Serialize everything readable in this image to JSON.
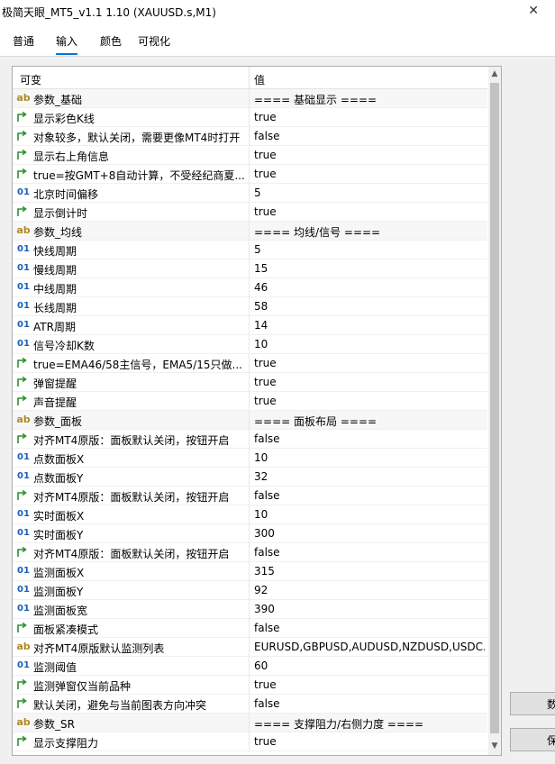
{
  "window": {
    "title": "极简天眼_MT5_v1.1 1.10 (XAUUSD.s,M1)",
    "close_glyph": "✕"
  },
  "tabs": [
    "普通",
    "输入",
    "颜色",
    "可视化"
  ],
  "active_tab": "输入",
  "grid": {
    "header": {
      "name": "可变",
      "value": "值"
    },
    "rows": [
      {
        "type": "ab",
        "name": "参数_基础",
        "value": "==== 基础显示 ====",
        "group": true
      },
      {
        "type": "bool",
        "name": "显示彩色K线",
        "value": "true"
      },
      {
        "type": "bool",
        "name": "对象较多，默认关闭，需要更像MT4时打开",
        "value": "false"
      },
      {
        "type": "bool",
        "name": "显示右上角信息",
        "value": "true"
      },
      {
        "type": "bool",
        "name": "true=按GMT+8自动计算，不受经纪商夏...",
        "value": "true"
      },
      {
        "type": "01",
        "name": "北京时间偏移",
        "value": "5"
      },
      {
        "type": "bool",
        "name": "显示倒计时",
        "value": "true"
      },
      {
        "type": "ab",
        "name": "参数_均线",
        "value": "==== 均线/信号 ====",
        "group": true
      },
      {
        "type": "01",
        "name": "快线周期",
        "value": "5"
      },
      {
        "type": "01",
        "name": "慢线周期",
        "value": "15"
      },
      {
        "type": "01",
        "name": "中线周期",
        "value": "46"
      },
      {
        "type": "01",
        "name": "长线周期",
        "value": "58"
      },
      {
        "type": "01",
        "name": "ATR周期",
        "value": "14"
      },
      {
        "type": "01",
        "name": "信号冷却K数",
        "value": "10"
      },
      {
        "type": "bool",
        "name": "true=EMA46/58主信号，EMA5/15只做...",
        "value": "true"
      },
      {
        "type": "bool",
        "name": "弹窗提醒",
        "value": "true"
      },
      {
        "type": "bool",
        "name": "声音提醒",
        "value": "true"
      },
      {
        "type": "ab",
        "name": "参数_面板",
        "value": "==== 面板布局 ====",
        "group": true
      },
      {
        "type": "bool",
        "name": "对齐MT4原版：面板默认关闭，按钮开启",
        "value": "false"
      },
      {
        "type": "01",
        "name": "点数面板X",
        "value": "10"
      },
      {
        "type": "01",
        "name": "点数面板Y",
        "value": "32"
      },
      {
        "type": "bool",
        "name": "对齐MT4原版：面板默认关闭，按钮开启",
        "value": "false"
      },
      {
        "type": "01",
        "name": "实时面板X",
        "value": "10"
      },
      {
        "type": "01",
        "name": "实时面板Y",
        "value": "300"
      },
      {
        "type": "bool",
        "name": "对齐MT4原版：面板默认关闭，按钮开启",
        "value": "false"
      },
      {
        "type": "01",
        "name": "监测面板X",
        "value": "315"
      },
      {
        "type": "01",
        "name": "监测面板Y",
        "value": "92"
      },
      {
        "type": "01",
        "name": "监测面板宽",
        "value": "390"
      },
      {
        "type": "bool",
        "name": "面板紧凑模式",
        "value": "false"
      },
      {
        "type": "ab",
        "name": "对齐MT4原版默认监测列表",
        "value": "EURUSD,GBPUSD,AUDUSD,NZDUSD,USDC..."
      },
      {
        "type": "01",
        "name": "监测阈值",
        "value": "60"
      },
      {
        "type": "bool",
        "name": "监测弹窗仅当前品种",
        "value": "true"
      },
      {
        "type": "bool",
        "name": "默认关闭，避免与当前图表方向冲突",
        "value": "false"
      },
      {
        "type": "ab",
        "name": "参数_SR",
        "value": "==== 支撑阻力/右侧力度 ====",
        "group": true
      },
      {
        "type": "bool",
        "name": "显示支撑阻力",
        "value": "true"
      }
    ]
  },
  "buttons": {
    "load": "数",
    "save": "保"
  },
  "icons": {
    "ab": "ab",
    "01": "01",
    "bool": "bool-arrow-icon"
  },
  "colors": {
    "accent": "#0078d7",
    "ab_icon": "#b08a20",
    "num_icon": "#1a5fb4",
    "bool_icon": "#2f8f2f"
  }
}
